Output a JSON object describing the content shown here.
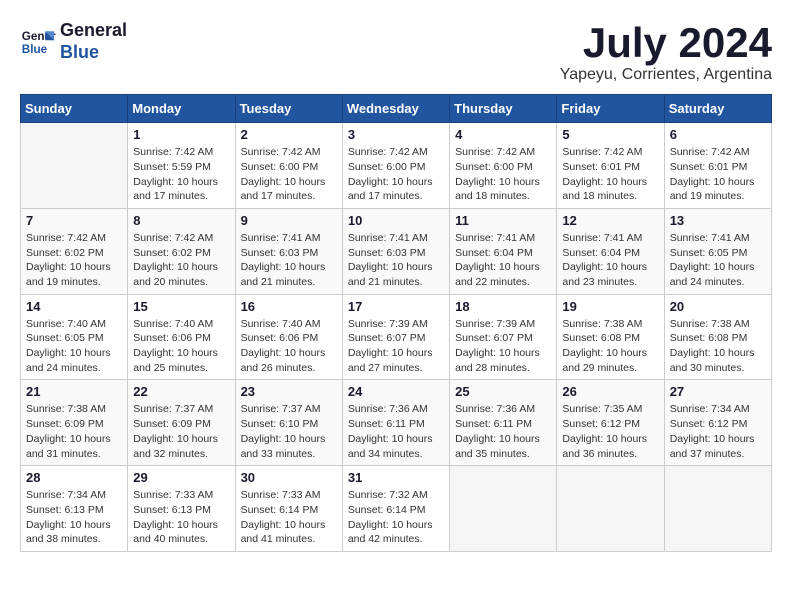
{
  "logo": {
    "line1": "General",
    "line2": "Blue"
  },
  "title": "July 2024",
  "location": "Yapeyu, Corrientes, Argentina",
  "days_of_week": [
    "Sunday",
    "Monday",
    "Tuesday",
    "Wednesday",
    "Thursday",
    "Friday",
    "Saturday"
  ],
  "weeks": [
    [
      {
        "day": "",
        "info": ""
      },
      {
        "day": "1",
        "info": "Sunrise: 7:42 AM\nSunset: 5:59 PM\nDaylight: 10 hours\nand 17 minutes."
      },
      {
        "day": "2",
        "info": "Sunrise: 7:42 AM\nSunset: 6:00 PM\nDaylight: 10 hours\nand 17 minutes."
      },
      {
        "day": "3",
        "info": "Sunrise: 7:42 AM\nSunset: 6:00 PM\nDaylight: 10 hours\nand 17 minutes."
      },
      {
        "day": "4",
        "info": "Sunrise: 7:42 AM\nSunset: 6:00 PM\nDaylight: 10 hours\nand 18 minutes."
      },
      {
        "day": "5",
        "info": "Sunrise: 7:42 AM\nSunset: 6:01 PM\nDaylight: 10 hours\nand 18 minutes."
      },
      {
        "day": "6",
        "info": "Sunrise: 7:42 AM\nSunset: 6:01 PM\nDaylight: 10 hours\nand 19 minutes."
      }
    ],
    [
      {
        "day": "7",
        "info": "Sunrise: 7:42 AM\nSunset: 6:02 PM\nDaylight: 10 hours\nand 19 minutes."
      },
      {
        "day": "8",
        "info": "Sunrise: 7:42 AM\nSunset: 6:02 PM\nDaylight: 10 hours\nand 20 minutes."
      },
      {
        "day": "9",
        "info": "Sunrise: 7:41 AM\nSunset: 6:03 PM\nDaylight: 10 hours\nand 21 minutes."
      },
      {
        "day": "10",
        "info": "Sunrise: 7:41 AM\nSunset: 6:03 PM\nDaylight: 10 hours\nand 21 minutes."
      },
      {
        "day": "11",
        "info": "Sunrise: 7:41 AM\nSunset: 6:04 PM\nDaylight: 10 hours\nand 22 minutes."
      },
      {
        "day": "12",
        "info": "Sunrise: 7:41 AM\nSunset: 6:04 PM\nDaylight: 10 hours\nand 23 minutes."
      },
      {
        "day": "13",
        "info": "Sunrise: 7:41 AM\nSunset: 6:05 PM\nDaylight: 10 hours\nand 24 minutes."
      }
    ],
    [
      {
        "day": "14",
        "info": "Sunrise: 7:40 AM\nSunset: 6:05 PM\nDaylight: 10 hours\nand 24 minutes."
      },
      {
        "day": "15",
        "info": "Sunrise: 7:40 AM\nSunset: 6:06 PM\nDaylight: 10 hours\nand 25 minutes."
      },
      {
        "day": "16",
        "info": "Sunrise: 7:40 AM\nSunset: 6:06 PM\nDaylight: 10 hours\nand 26 minutes."
      },
      {
        "day": "17",
        "info": "Sunrise: 7:39 AM\nSunset: 6:07 PM\nDaylight: 10 hours\nand 27 minutes."
      },
      {
        "day": "18",
        "info": "Sunrise: 7:39 AM\nSunset: 6:07 PM\nDaylight: 10 hours\nand 28 minutes."
      },
      {
        "day": "19",
        "info": "Sunrise: 7:38 AM\nSunset: 6:08 PM\nDaylight: 10 hours\nand 29 minutes."
      },
      {
        "day": "20",
        "info": "Sunrise: 7:38 AM\nSunset: 6:08 PM\nDaylight: 10 hours\nand 30 minutes."
      }
    ],
    [
      {
        "day": "21",
        "info": "Sunrise: 7:38 AM\nSunset: 6:09 PM\nDaylight: 10 hours\nand 31 minutes."
      },
      {
        "day": "22",
        "info": "Sunrise: 7:37 AM\nSunset: 6:09 PM\nDaylight: 10 hours\nand 32 minutes."
      },
      {
        "day": "23",
        "info": "Sunrise: 7:37 AM\nSunset: 6:10 PM\nDaylight: 10 hours\nand 33 minutes."
      },
      {
        "day": "24",
        "info": "Sunrise: 7:36 AM\nSunset: 6:11 PM\nDaylight: 10 hours\nand 34 minutes."
      },
      {
        "day": "25",
        "info": "Sunrise: 7:36 AM\nSunset: 6:11 PM\nDaylight: 10 hours\nand 35 minutes."
      },
      {
        "day": "26",
        "info": "Sunrise: 7:35 AM\nSunset: 6:12 PM\nDaylight: 10 hours\nand 36 minutes."
      },
      {
        "day": "27",
        "info": "Sunrise: 7:34 AM\nSunset: 6:12 PM\nDaylight: 10 hours\nand 37 minutes."
      }
    ],
    [
      {
        "day": "28",
        "info": "Sunrise: 7:34 AM\nSunset: 6:13 PM\nDaylight: 10 hours\nand 38 minutes."
      },
      {
        "day": "29",
        "info": "Sunrise: 7:33 AM\nSunset: 6:13 PM\nDaylight: 10 hours\nand 40 minutes."
      },
      {
        "day": "30",
        "info": "Sunrise: 7:33 AM\nSunset: 6:14 PM\nDaylight: 10 hours\nand 41 minutes."
      },
      {
        "day": "31",
        "info": "Sunrise: 7:32 AM\nSunset: 6:14 PM\nDaylight: 10 hours\nand 42 minutes."
      },
      {
        "day": "",
        "info": ""
      },
      {
        "day": "",
        "info": ""
      },
      {
        "day": "",
        "info": ""
      }
    ]
  ]
}
